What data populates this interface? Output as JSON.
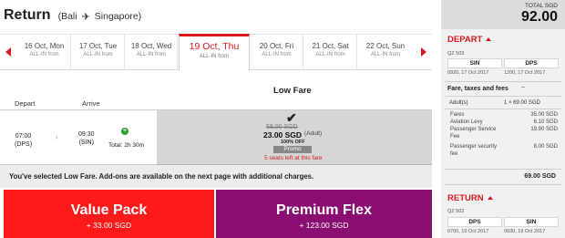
{
  "header": {
    "title": "Return",
    "route_open": "(",
    "origin": "Bali",
    "destination": "Singapore",
    "route_close": ")"
  },
  "dates": [
    {
      "label": "16 Oct, Mon",
      "sub": "ALL-IN from"
    },
    {
      "label": "17 Oct, Tue",
      "sub": "ALL-IN from"
    },
    {
      "label": "18 Oct, Wed",
      "sub": "ALL-IN from"
    },
    {
      "label": "19 Oct, Thu",
      "sub": "ALL-IN from",
      "selected": true
    },
    {
      "label": "20 Oct, Fri",
      "sub": "ALL-IN from"
    },
    {
      "label": "21 Oct, Sat",
      "sub": "ALL-IN from"
    },
    {
      "label": "22 Oct, Sun",
      "sub": "ALL-IN from"
    }
  ],
  "table": {
    "depart_header": "Depart",
    "arrive_header": "Arrive",
    "fare_header": "Low Fare"
  },
  "flight": {
    "depart_time": "07:00",
    "depart_code": "(DPS)",
    "arrive_time": "09:30",
    "arrive_code": "(SIN)",
    "plus_icon": "+",
    "total_duration": "Total: 2h 30m",
    "chevron": "›"
  },
  "fare": {
    "check": "✔",
    "old_price": "58.00 SGD",
    "price": "23.00 SGD",
    "adult": "(Adult)",
    "discount": "100% OFF",
    "promo": "Promo",
    "seats_left": "5 seats left at this fare"
  },
  "notice": "You've selected Low Fare. Add-ons are available on the next page with additional charges.",
  "packs": [
    {
      "name": "Value Pack",
      "price": "+ 33.00 SGD"
    },
    {
      "name": "Premium Flex",
      "price": "+ 123.00 SGD"
    }
  ],
  "summary": {
    "total_label": "TOTAL SGD",
    "total_value": "92.00",
    "depart": {
      "title": "DEPART",
      "flight_no": "QZ 503",
      "from_code": "SIN",
      "to_code": "DPS",
      "from_time": "0920, 17 Oct 2017",
      "to_time": "1200, 17 Oct 2017"
    },
    "fees": {
      "title": "Fare, taxes and fees",
      "adult_label": "Adult(s)",
      "adult_value": "1 × 69.00 SGD",
      "rows": [
        {
          "label": "Fares",
          "amount": "35.00 SGD"
        },
        {
          "label": "Aviation Levy",
          "amount": "6.10 SGD"
        },
        {
          "label": "Passenger Service",
          "amount": "19.90 SGD"
        },
        {
          "label": "Fee",
          "amount": ""
        },
        {
          "label": "Passenger security",
          "amount": "8.00 SGD"
        },
        {
          "label": "fee",
          "amount": ""
        }
      ],
      "subtotal": "69.00 SGD"
    },
    "return": {
      "title": "RETURN",
      "flight_no": "QZ 502",
      "from_code": "DPS",
      "to_code": "SIN",
      "from_time": "0700, 19 Oct 2017",
      "to_time": "0930, 19 Oct 2017"
    }
  },
  "colors": {
    "accent_red": "#d71920",
    "value_pack": "#ff1a1a",
    "premium_flex": "#8a0e72",
    "promo_grey": "#888888"
  }
}
